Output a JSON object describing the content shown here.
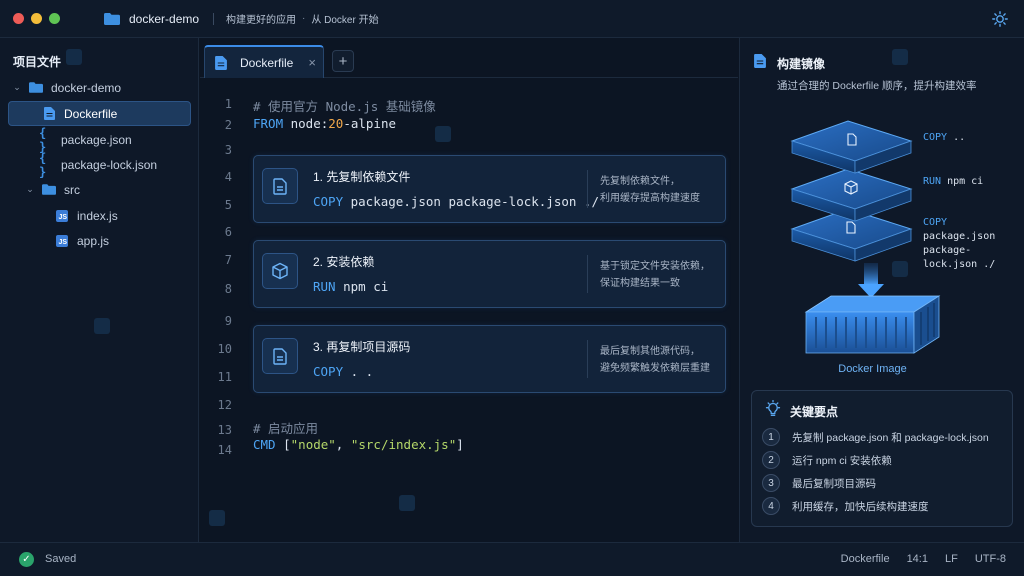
{
  "titlebar": {
    "project_name": "docker-demo",
    "tagline": "构建更好的应用",
    "dot": "·",
    "subtagline": "从 Docker 开始"
  },
  "sidebar": {
    "title": "项目文件",
    "items": [
      {
        "label": "docker-demo",
        "type": "folder",
        "expanded": true
      },
      {
        "label": "Dockerfile",
        "type": "file",
        "active": true
      },
      {
        "label": "package.json",
        "type": "json"
      },
      {
        "label": "package-lock.json",
        "type": "json"
      },
      {
        "label": "src",
        "type": "folder",
        "expanded": true
      },
      {
        "label": "index.js",
        "type": "js"
      },
      {
        "label": "app.js",
        "type": "js"
      }
    ],
    "json_glyph": "{ }",
    "js_glyph": "JS",
    "chevron_glyph": "⌄"
  },
  "editor": {
    "tab_label": "Dockerfile",
    "tab_close": "×",
    "tab_add": "+",
    "line_numbers": [
      "1",
      "2",
      "3",
      "4",
      "5",
      "6",
      "7",
      "8",
      "9",
      "10",
      "11",
      "12",
      "13",
      "14"
    ],
    "line1_comment": "# 使用官方 Node.js 基础镜像",
    "line2_kw": "FROM",
    "line2_a": " node:",
    "line2_num": "20",
    "line2_b": "-alpine",
    "blocks": [
      {
        "title": "1. 先复制依赖文件",
        "kw": "COPY",
        "args": " package.json package-lock.json ./",
        "note1": "先复制依赖文件，",
        "note2": "利用缓存提高构建速度"
      },
      {
        "title": "2. 安装依赖",
        "kw": "RUN",
        "args": " npm ci",
        "note1": "基于锁定文件安装依赖，",
        "note2": "保证构建结果一致"
      },
      {
        "title": "3. 再复制项目源码",
        "kw": "COPY",
        "args": " . .",
        "note1": "最后复制其他源代码，",
        "note2": "避免频繁触发依赖层重建"
      }
    ],
    "line13_comment": "# 启动应用",
    "line14_kw": "CMD",
    "line14_open": " [",
    "line14_s1": "\"node\"",
    "line14_comma": ", ",
    "line14_s2": "\"src/index.js\"",
    "line14_close": "]"
  },
  "panel": {
    "title": "构建镜像",
    "subtitle": "通过合理的 Dockerfile 顺序，提升构建效率",
    "layer1_kw": "COPY",
    "layer1_args": " ..",
    "layer2_kw": "RUN",
    "layer2_args": " npm ci",
    "layer3_kw": "COPY",
    "layer3_args": " package.json",
    "layer3_args2": "package-lock.json ./",
    "image_label": "Docker Image",
    "keypoints_title": "关键要点",
    "keypoints": [
      {
        "num": "1",
        "text": "先复制 package.json 和 package-lock.json"
      },
      {
        "num": "2",
        "text": "运行 npm ci 安装依赖"
      },
      {
        "num": "3",
        "text": "最后复制项目源码"
      },
      {
        "num": "4",
        "text": "利用缓存，加快后续构建速度"
      }
    ]
  },
  "statusbar": {
    "saved": "Saved",
    "file": "Dockerfile",
    "position": "14:1",
    "eol": "LF",
    "encoding": "UTF-8"
  },
  "colors": {
    "accent": "#3c8ce7",
    "keyword": "#4ea5f5",
    "string": "#b5d86a",
    "number": "#f0a74a",
    "success": "#2aa36b"
  },
  "icons": [
    "folder-icon",
    "sun-icon",
    "file-icon",
    "json-icon",
    "js-icon",
    "cube-icon",
    "lightbulb-icon",
    "check-icon",
    "chevron-down-icon",
    "close-icon",
    "plus-icon"
  ]
}
